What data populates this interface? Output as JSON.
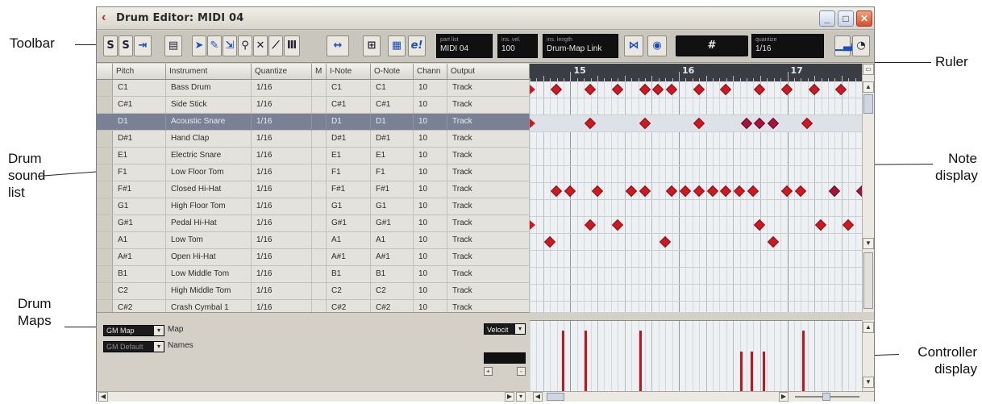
{
  "window": {
    "title": "Drum Editor: MIDI 04",
    "minimize": "_",
    "maximize": "□",
    "close": "✕"
  },
  "callouts": {
    "toolbar": "Toolbar",
    "ruler": "Ruler",
    "drum_sound_list": [
      "Drum",
      "sound",
      "list"
    ],
    "note_display": [
      "Note",
      "display"
    ],
    "drum_maps": [
      "Drum",
      "Maps"
    ],
    "controller_display": [
      "Controller",
      "display"
    ]
  },
  "toolbar": {
    "solo": "S",
    "listen": "S",
    "autoscroll": "⇥",
    "info": "▤",
    "quantize_link": "⇲",
    "draw": "✎",
    "zoom": "🔍",
    "delete": "✕",
    "line": "⟋",
    "insert_velocity": "Ⅲ",
    "cycle": "↔",
    "snap": "⊞",
    "color": "▦",
    "edit_inplace": "e!",
    "part_list_label": "part list",
    "part_list_value": "MIDI 04",
    "ins_vel_label": "ins. vel.",
    "ins_vel_value": "100",
    "ins_length_label": "ins. length",
    "ins_length_value": "Drum-Map Link",
    "snap_tool": "⋈",
    "step": "◉",
    "mouse_pos": "#",
    "quantize_label": "quantize",
    "quantize_value": "1/16",
    "level": "▁▃▅",
    "clock": "◔"
  },
  "columns": [
    "Pitch",
    "Instrument",
    "Quantize",
    "M",
    "I-Note",
    "O-Note",
    "Chann",
    "Output"
  ],
  "drum_sounds": [
    {
      "pitch": "C1",
      "instrument": "Bass Drum",
      "quantize": "1/16",
      "inote": "C1",
      "onote": "C1",
      "channel": "10",
      "output": "Track"
    },
    {
      "pitch": "C#1",
      "instrument": "Side Stick",
      "quantize": "1/16",
      "inote": "C#1",
      "onote": "C#1",
      "channel": "10",
      "output": "Track"
    },
    {
      "pitch": "D1",
      "instrument": "Acoustic Snare",
      "quantize": "1/16",
      "inote": "D1",
      "onote": "D1",
      "channel": "10",
      "output": "Track"
    },
    {
      "pitch": "D#1",
      "instrument": "Hand Clap",
      "quantize": "1/16",
      "inote": "D#1",
      "onote": "D#1",
      "channel": "10",
      "output": "Track"
    },
    {
      "pitch": "E1",
      "instrument": "Electric Snare",
      "quantize": "1/16",
      "inote": "E1",
      "onote": "E1",
      "channel": "10",
      "output": "Track"
    },
    {
      "pitch": "F1",
      "instrument": "Low Floor Tom",
      "quantize": "1/16",
      "inote": "F1",
      "onote": "F1",
      "channel": "10",
      "output": "Track"
    },
    {
      "pitch": "F#1",
      "instrument": "Closed Hi-Hat",
      "quantize": "1/16",
      "inote": "F#1",
      "onote": "F#1",
      "channel": "10",
      "output": "Track"
    },
    {
      "pitch": "G1",
      "instrument": "High Floor Tom",
      "quantize": "1/16",
      "inote": "G1",
      "onote": "G1",
      "channel": "10",
      "output": "Track"
    },
    {
      "pitch": "G#1",
      "instrument": "Pedal Hi-Hat",
      "quantize": "1/16",
      "inote": "G#1",
      "onote": "G#1",
      "channel": "10",
      "output": "Track"
    },
    {
      "pitch": "A1",
      "instrument": "Low Tom",
      "quantize": "1/16",
      "inote": "A1",
      "onote": "A1",
      "channel": "10",
      "output": "Track"
    },
    {
      "pitch": "A#1",
      "instrument": "Open Hi-Hat",
      "quantize": "1/16",
      "inote": "A#1",
      "onote": "A#1",
      "channel": "10",
      "output": "Track"
    },
    {
      "pitch": "B1",
      "instrument": "Low Middle Tom",
      "quantize": "1/16",
      "inote": "B1",
      "onote": "B1",
      "channel": "10",
      "output": "Track"
    },
    {
      "pitch": "C2",
      "instrument": "High Middle Tom",
      "quantize": "1/16",
      "inote": "C2",
      "onote": "C2",
      "channel": "10",
      "output": "Track"
    },
    {
      "pitch": "C#2",
      "instrument": "Crash Cymbal 1",
      "quantize": "1/16",
      "inote": "C#2",
      "onote": "C#2",
      "channel": "10",
      "output": "Track"
    }
  ],
  "selected_row": 2,
  "maps": {
    "map_select": "GM Map",
    "map_label": "Map",
    "names_select": "GM Default",
    "names_label": "Names"
  },
  "controller": {
    "select": "Velocit",
    "plus": "+",
    "minus": "-"
  },
  "ruler": {
    "bars": [
      "15",
      "16",
      "17"
    ]
  },
  "notes": {
    "sixteenths_shown": 49,
    "rows": [
      [
        0,
        3,
        8,
        12,
        16,
        18,
        20,
        24,
        28,
        33,
        37,
        41,
        45
      ],
      [],
      [
        0,
        8,
        16,
        24,
        31,
        33,
        35,
        40
      ],
      [],
      [],
      [],
      [
        3,
        5,
        9,
        14,
        16,
        20,
        22,
        24,
        26,
        28,
        30,
        32,
        37,
        39,
        44,
        48
      ],
      [],
      [
        0,
        8,
        12,
        33,
        42,
        46
      ],
      [
        2,
        19,
        35
      ],
      [],
      [],
      [],
      []
    ],
    "triangle_starts": [
      0,
      2,
      8
    ]
  },
  "velocity": {
    "bars": [
      {
        "pos": 4.8,
        "level": 0.92
      },
      {
        "pos": 8.1,
        "level": 0.92
      },
      {
        "pos": 16.2,
        "level": 0.92
      },
      {
        "pos": 31.1,
        "level": 0.6
      },
      {
        "pos": 32.6,
        "level": 0.6
      },
      {
        "pos": 34.4,
        "level": 0.6
      },
      {
        "pos": 40.2,
        "level": 0.92
      }
    ]
  },
  "colors": {
    "note": "#d01820",
    "selection": "#7a8194",
    "title_accent": "#c8271c"
  }
}
